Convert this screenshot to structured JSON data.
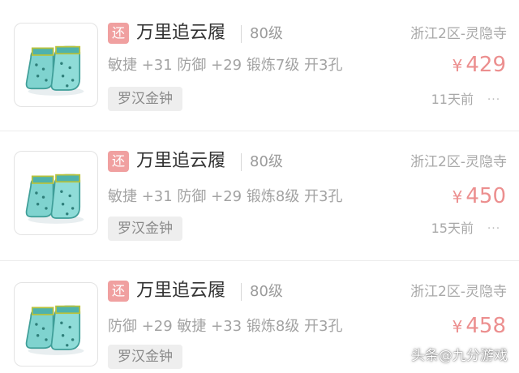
{
  "listings": [
    {
      "tag": "还",
      "name": "万里追云履",
      "level": "80级",
      "server": "浙江2区-灵隐寺",
      "stats": "敏捷 +31 防御 +29 锻炼7级 开3孔",
      "currency": "¥",
      "price": "429",
      "school": "罗汉金钟",
      "time": "11天前",
      "more": "···",
      "icon": "boots-item-icon"
    },
    {
      "tag": "还",
      "name": "万里追云履",
      "level": "80级",
      "server": "浙江2区-灵隐寺",
      "stats": "敏捷 +31 防御 +29 锻炼8级 开3孔",
      "currency": "¥",
      "price": "450",
      "school": "罗汉金钟",
      "time": "15天前",
      "more": "···",
      "icon": "boots-item-icon"
    },
    {
      "tag": "还",
      "name": "万里追云履",
      "level": "80级",
      "server": "浙江2区-灵隐寺",
      "stats": "防御 +29 敏捷 +33 锻炼8级 开3孔",
      "currency": "¥",
      "price": "458",
      "school": "罗汉金钟",
      "time": "",
      "more": "",
      "icon": "boots-item-icon"
    }
  ],
  "watermark": "头条@九分游戏",
  "colors": {
    "price": "#ec8f8f",
    "tag_bg": "#f0a0a0",
    "boot": "#7fd3cf",
    "boot_dark": "#3f9e98",
    "boot_trim": "#b9c23a"
  }
}
